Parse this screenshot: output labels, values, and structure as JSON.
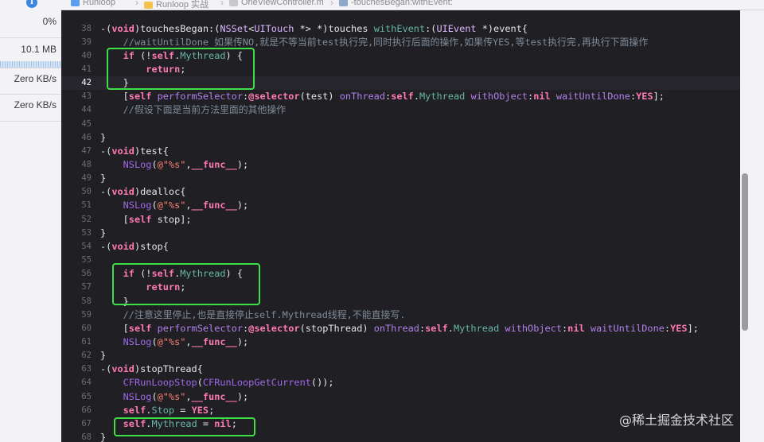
{
  "debug_navigator": {
    "cpu": "0%",
    "memory": "10.1 MB",
    "disk": "Zero KB/s",
    "network": "Zero KB/s"
  },
  "breadcrumbs": [
    "Runloop",
    "Runloop 实战",
    "OneViewController.m",
    "-touchesBegan:withEvent:"
  ],
  "current_line": 42,
  "lines": [
    {
      "n": "38"
    },
    {
      "n": "39"
    },
    {
      "n": "40"
    },
    {
      "n": "41"
    },
    {
      "n": "42"
    },
    {
      "n": "43"
    },
    {
      "n": "44"
    },
    {
      "n": "45"
    },
    {
      "n": "46"
    },
    {
      "n": "47"
    },
    {
      "n": "48"
    },
    {
      "n": "49"
    },
    {
      "n": "50"
    },
    {
      "n": "51"
    },
    {
      "n": "52"
    },
    {
      "n": "53"
    },
    {
      "n": "54"
    },
    {
      "n": "55"
    },
    {
      "n": "56"
    },
    {
      "n": "57"
    },
    {
      "n": "58"
    },
    {
      "n": "59"
    },
    {
      "n": "60"
    },
    {
      "n": "61"
    },
    {
      "n": "62"
    },
    {
      "n": "63"
    },
    {
      "n": "64"
    },
    {
      "n": "65"
    },
    {
      "n": "66"
    },
    {
      "n": "67"
    },
    {
      "n": "68"
    }
  ],
  "code": {
    "l38_a": "-(",
    "l38_void": "void",
    "l38_b": ")touchesBegan:(",
    "l38_nsset": "NSSet",
    "l38_c": "<",
    "l38_uitouch": "UITouch",
    "l38_d": " *> *)touches ",
    "l38_withevent": "withEvent",
    "l38_e": ":(",
    "l38_uievent": "UIEvent",
    "l38_f": " *)event{",
    "l39": "    //waitUntilDone 如果传NO,就是不等当前test执行完,同时执行后面的操作,如果传YES,等test执行完,再执行下面操作",
    "l40_a": "    ",
    "l40_if": "if",
    "l40_b": " (!",
    "l40_self": "self",
    "l40_c": ".",
    "l40_prop": "Mythread",
    "l40_d": ") {",
    "l41_a": "        ",
    "l41_ret": "return",
    "l41_b": ";",
    "l42": "    }",
    "l43_a": "    [",
    "l43_self": "self",
    "l43_b": " ",
    "l43_ps": "performSelector",
    "l43_c": ":",
    "l43_sel": "@selector",
    "l43_d": "(test) ",
    "l43_ot": "onThread",
    "l43_e": ":",
    "l43_self2": "self",
    "l43_f": ".",
    "l43_prop": "Mythread",
    "l43_g": " ",
    "l43_wo": "withObject",
    "l43_h": ":",
    "l43_nil": "nil",
    "l43_i": " ",
    "l43_wud": "waitUntilDone",
    "l43_j": ":",
    "l43_yes": "YES",
    "l43_k": "];",
    "l44": "    //假设下面是当前方法里面的其他操作",
    "l46": "}",
    "l47_a": "-(",
    "l47_void": "void",
    "l47_b": ")test{",
    "l48_a": "    ",
    "l48_nslog": "NSLog",
    "l48_b": "(",
    "l48_str": "@\"%s\"",
    "l48_c": ",",
    "l48_func": "__func__",
    "l48_d": ");",
    "l49": "}",
    "l50_a": "-(",
    "l50_void": "void",
    "l50_b": ")dealloc{",
    "l51_a": "    ",
    "l51_nslog": "NSLog",
    "l51_b": "(",
    "l51_str": "@\"%s\"",
    "l51_c": ",",
    "l51_func": "__func__",
    "l51_d": ");",
    "l52_a": "    [",
    "l52_self": "self",
    "l52_b": " stop];",
    "l53": "}",
    "l54_a": "-(",
    "l54_void": "void",
    "l54_b": ")stop{",
    "l56_a": "    ",
    "l56_if": "if",
    "l56_b": " (!",
    "l56_self": "self",
    "l56_c": ".",
    "l56_prop": "Mythread",
    "l56_d": ") {",
    "l57_a": "        ",
    "l57_ret": "return",
    "l57_b": ";",
    "l58": "    }",
    "l59": "    //注意这里停止,也是直接停止self.Mythread线程,不能直接写.",
    "l60_a": "    [",
    "l60_self": "self",
    "l60_b": " ",
    "l60_ps": "performSelector",
    "l60_c": ":",
    "l60_sel": "@selector",
    "l60_d": "(stopThread) ",
    "l60_ot": "onThread",
    "l60_e": ":",
    "l60_self2": "self",
    "l60_f": ".",
    "l60_prop": "Mythread",
    "l60_g": " ",
    "l60_wo": "withObject",
    "l60_h": ":",
    "l60_nil": "nil",
    "l60_i": " ",
    "l60_wud": "waitUntilDone",
    "l60_j": ":",
    "l60_yes": "YES",
    "l60_k": "];",
    "l61_a": "    ",
    "l61_nslog": "NSLog",
    "l61_b": "(",
    "l61_str": "@\"%s\"",
    "l61_c": ",",
    "l61_func": "__func__",
    "l61_d": ");",
    "l62": "}",
    "l63_a": "-(",
    "l63_void": "void",
    "l63_b": ")stopThread{",
    "l64_a": "    ",
    "l64_cf": "CFRunLoopStop",
    "l64_b": "(",
    "l64_cf2": "CFRunLoopGetCurrent",
    "l64_c": "());",
    "l65_a": "    ",
    "l65_nslog": "NSLog",
    "l65_b": "(",
    "l65_str": "@\"%s\"",
    "l65_c": ",",
    "l65_func": "__func__",
    "l65_d": ");",
    "l66_a": "    ",
    "l66_self": "self",
    "l66_b": ".",
    "l66_prop": "Stop",
    "l66_c": " = ",
    "l66_yes": "YES",
    "l66_d": ";",
    "l67_a": "    ",
    "l67_self": "self",
    "l67_b": ".",
    "l67_prop": "Mythread",
    "l67_c": " = ",
    "l67_nil": "nil",
    "l67_d": ";",
    "l68": "}"
  },
  "watermark": "@稀土掘金技术社区"
}
